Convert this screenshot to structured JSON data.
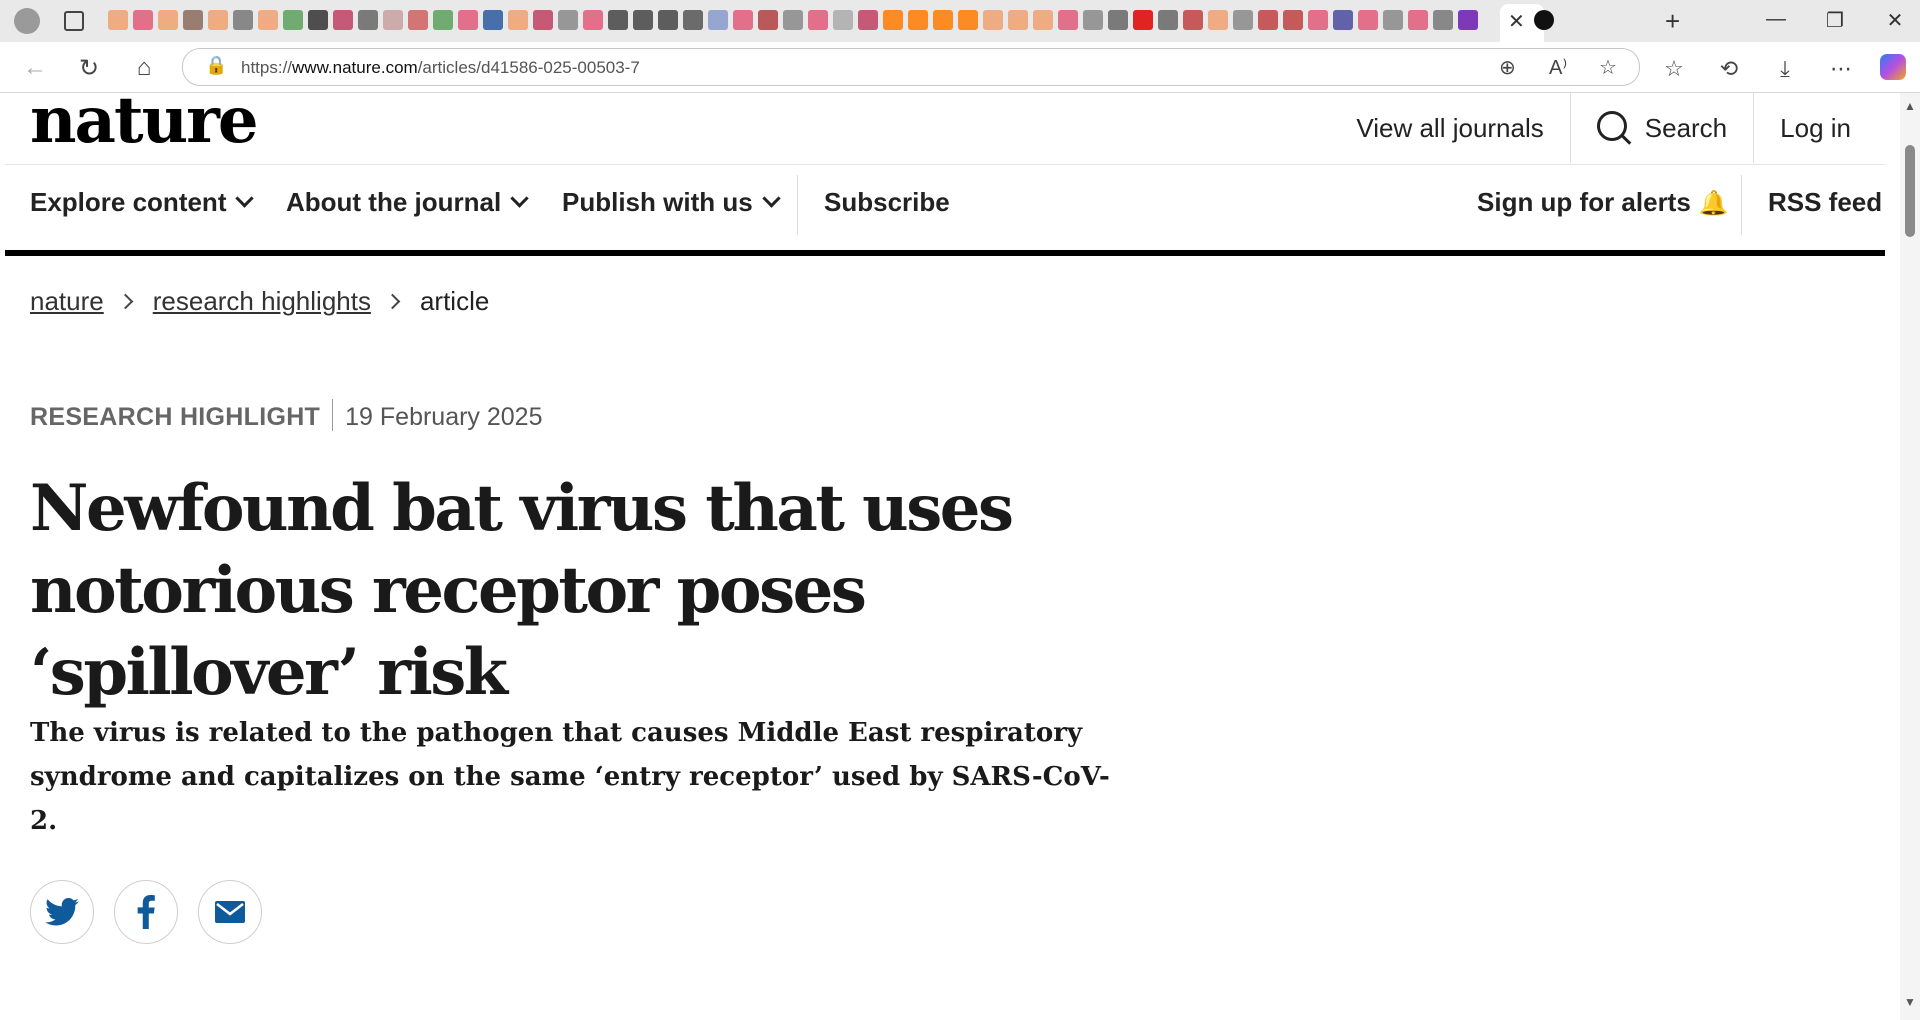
{
  "browser": {
    "url_prefix": "https://",
    "url_host": "www.nature.com",
    "url_path": "/articles/d41586-025-00503-7",
    "colors": {
      "chrome_bg": "#e9e9ea",
      "address_bg": "#ffffff"
    }
  },
  "site": {
    "logo": "nature",
    "header_links": [
      "View all journals",
      "Search",
      "Log in"
    ],
    "nav": {
      "explore": "Explore content",
      "about": "About the journal",
      "publish": "Publish with us",
      "subscribe": "Subscribe",
      "alerts": "Sign up for alerts",
      "rss": "RSS feed"
    }
  },
  "breadcrumb": [
    "nature",
    "research highlights",
    "article"
  ],
  "article": {
    "type": "RESEARCH HIGHLIGHT",
    "date": "19 February 2025",
    "title": "Newfound bat virus that uses notorious receptor poses ‘spillover’ risk",
    "standfirst": "The virus is related to the pathogen that causes Middle East respiratory syndrome and capitalizes on the same ‘entry receptor’ used by SARS-CoV-2."
  },
  "share_icons": [
    "twitter-icon",
    "facebook-icon",
    "email-icon"
  ],
  "colors": {
    "share_blue": "#0f5a9a",
    "text": "#222222",
    "meta_gray": "#666666"
  }
}
